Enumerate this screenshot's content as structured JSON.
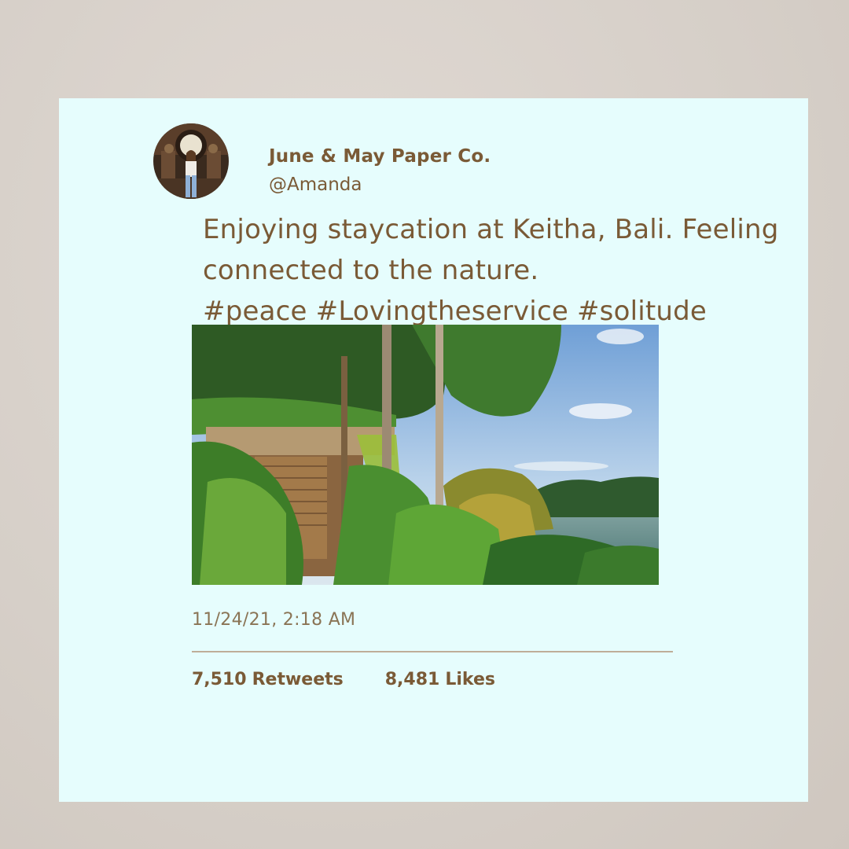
{
  "tweet": {
    "display_name": "June & May Paper Co.",
    "handle": "@Amanda",
    "text_lines": [
      "Enjoying staycation at Keitha, Bali. Feeling",
      "connected to the nature.",
      "#peace #Lovingtheservice #solitude"
    ],
    "timestamp": "11/24/21, 2:18 AM",
    "retweets_count": "7,510",
    "retweets_label": "Retweets",
    "likes_count": "8,481",
    "likes_label": "Likes"
  },
  "colors": {
    "background": "#d6cfc8",
    "card": "#e6fdfd",
    "text": "#7a5a36",
    "divider": "#bfae98"
  }
}
